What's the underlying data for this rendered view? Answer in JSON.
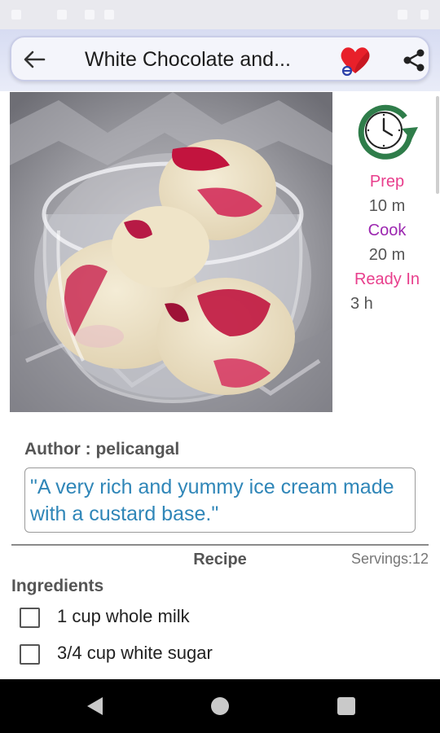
{
  "app_bar": {
    "title": "White Chocolate and...",
    "back_icon": "arrow-left-icon",
    "favorite_icon": "heart-icon",
    "share_icon": "share-icon"
  },
  "times": {
    "icon": "clock-refresh-icon",
    "prep_label": "Prep",
    "prep_value": "10 m",
    "cook_label": "Cook",
    "cook_value": "20 m",
    "ready_label": "Ready In",
    "ready_value": "3 h",
    "colors": {
      "prep": "#e83e8c",
      "cook": "#9c27b0",
      "ready": "#e83e8c",
      "icon": "#2f7d4a"
    }
  },
  "author": {
    "label": "Author : pelicangal"
  },
  "description": "\"A very rich and yummy ice cream made with a custard base.\"",
  "recipe_header": {
    "label": "Recipe",
    "servings": "Servings:12"
  },
  "ingredients": {
    "heading": "Ingredients",
    "items": [
      {
        "text": "1 cup whole milk",
        "checked": false
      },
      {
        "text": "3/4 cup white sugar",
        "checked": false
      }
    ]
  },
  "nav_bar": {
    "back_icon": "nav-back-icon",
    "home_icon": "nav-home-icon",
    "recents_icon": "nav-recents-icon"
  }
}
